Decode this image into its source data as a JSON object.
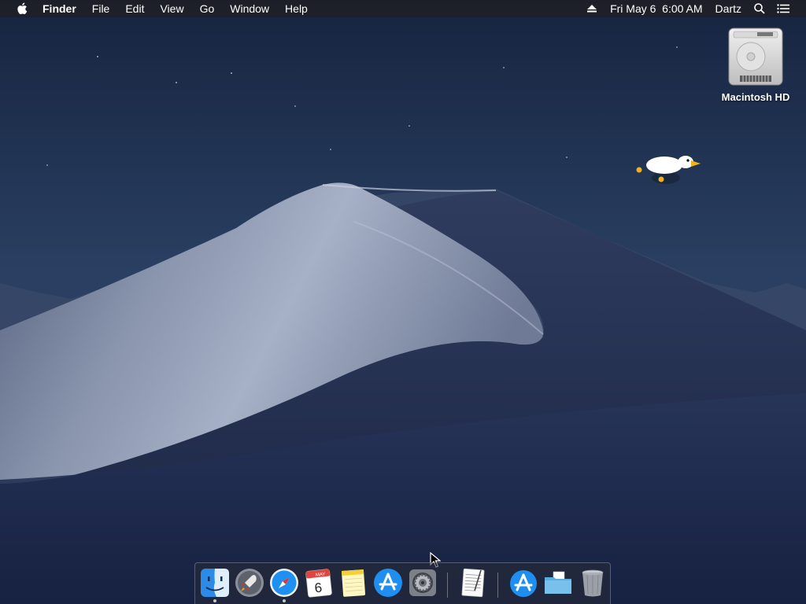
{
  "menubar": {
    "apple_icon": "apple-icon",
    "app_name": "Finder",
    "items": [
      "File",
      "Edit",
      "View",
      "Go",
      "Window",
      "Help"
    ],
    "status": {
      "eject_icon": "eject-icon",
      "datetime": "Fri May 6  6:00 AM",
      "user": "Dartz",
      "search_icon": "search-icon",
      "notification_icon": "list-icon"
    }
  },
  "desktop": {
    "disk_label": "Macintosh HD",
    "disk_icon": "hard-drive-icon",
    "goose_icon": "goose-icon"
  },
  "dock": {
    "apps": [
      {
        "name": "Finder",
        "icon": "finder-icon",
        "running": true
      },
      {
        "name": "Launchpad",
        "icon": "launchpad-icon",
        "running": false
      },
      {
        "name": "Safari",
        "icon": "safari-icon",
        "running": true
      },
      {
        "name": "Calendar",
        "icon": "calendar-icon",
        "running": false,
        "month": "MAY",
        "day": "6"
      },
      {
        "name": "Notes",
        "icon": "notes-icon",
        "running": false
      },
      {
        "name": "App Store",
        "icon": "app-store-icon",
        "running": false
      },
      {
        "name": "System Preferences",
        "icon": "system-preferences-icon",
        "running": false
      },
      {
        "name": "TextEdit",
        "icon": "textedit-icon",
        "running": false
      },
      {
        "name": "Applications",
        "icon": "applications-folder-icon",
        "running": false
      },
      {
        "name": "Documents",
        "icon": "folder-icon",
        "running": false
      },
      {
        "name": "Trash",
        "icon": "trash-icon",
        "running": false
      }
    ]
  },
  "colors": {
    "menubar_bg": "#1e2026",
    "sky_top": "#1a2a47",
    "dune_light": "#8c97b0",
    "dune_dark": "#1d2846"
  }
}
